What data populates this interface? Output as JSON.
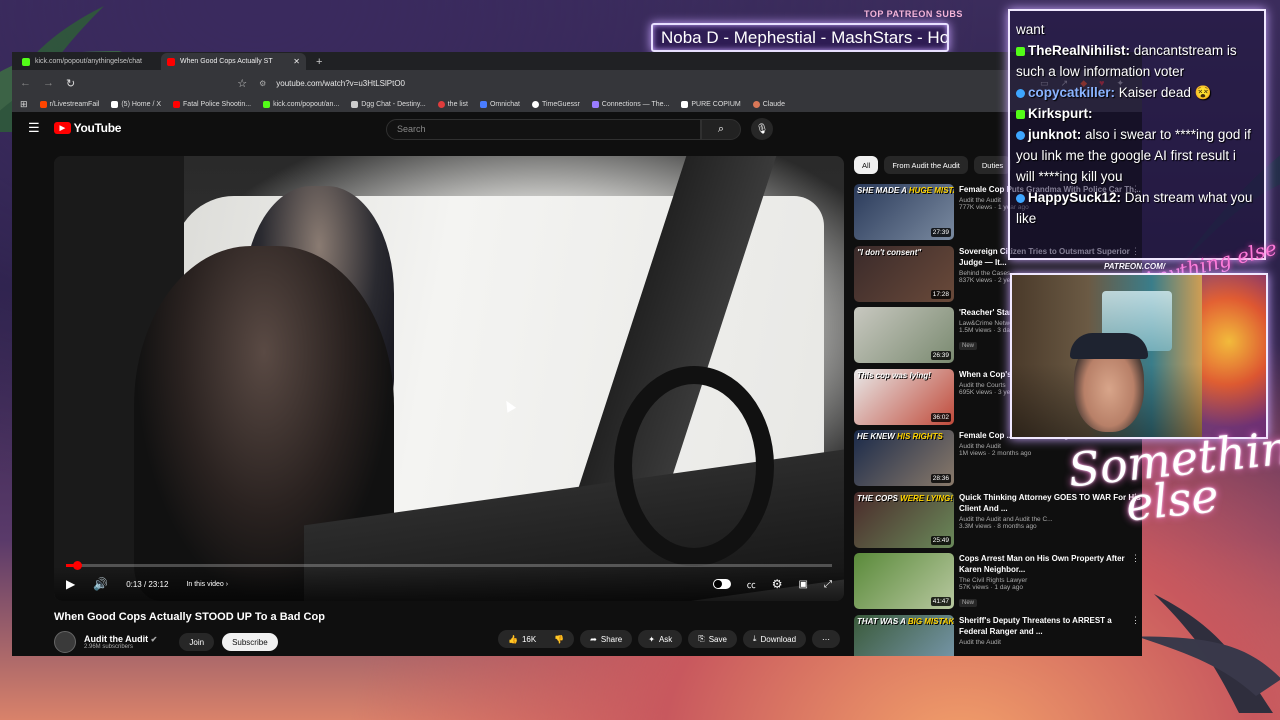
{
  "overlay": {
    "patreon_title": "TOP PATREON SUBS",
    "patreon_ticker": "Noba D - Mephestial - MashStars - Ho",
    "patreon_tag": "PATREON.COM/",
    "signature": "Anything else",
    "brand": "Something else",
    "chat": [
      {
        "badge": "",
        "user": "",
        "text": "want"
      },
      {
        "badge": "k",
        "user": "TheRealNihilist:",
        "text": " dancantstream is such a low information voter"
      },
      {
        "badge": "yt",
        "user": "copycatkiller:",
        "text": " Kaiser dead 😵"
      },
      {
        "badge": "k",
        "user": "Kirkspurt:",
        "text": ""
      },
      {
        "badge": "yt",
        "user": "junknot:",
        "text": " also i swear to ****ing god if you link me the google AI first result i will ****ing kill you"
      },
      {
        "badge": "yt",
        "user": "HappySuck12:",
        "text": " Dan stream what you like"
      }
    ]
  },
  "browser": {
    "tabs": [
      {
        "title": "kick.com/popout/anythingelse/chat",
        "active": false,
        "color": "#53fc18"
      },
      {
        "title": "When Good Cops Actually ST",
        "active": true,
        "color": "#ff0000"
      }
    ],
    "new_tab": "+",
    "url": "youtube.com/watch?v=u3HtLSlPtO0",
    "bookmarks": [
      {
        "label": "r/LivestreamFail",
        "color": "#ff4500"
      },
      {
        "label": "(5) Home / X",
        "color": "#ffffff"
      },
      {
        "label": "Fatal Police Shootin...",
        "color": "#ff0000"
      },
      {
        "label": "kick.com/popout/an...",
        "color": "#53fc18"
      },
      {
        "label": "Dgg Chat - Destiny...",
        "color": "#cccccc"
      },
      {
        "label": "the list",
        "color": "#e03c3c"
      },
      {
        "label": "Omnichat",
        "color": "#4a7dff"
      },
      {
        "label": "TimeGuessr",
        "color": "#ffffff"
      },
      {
        "label": "Connections — The...",
        "color": "#9a7cff"
      },
      {
        "label": "PURE COPIUM",
        "color": "#ffffff"
      },
      {
        "label": "Claude",
        "color": "#d97757"
      }
    ]
  },
  "youtube": {
    "logo": "YouTube",
    "search_placeholder": "Search",
    "player": {
      "time": "0:13 / 23:12",
      "in_this_video": "In this video",
      "progress_fraction": 0.0094
    },
    "video_title": "When Good Cops Actually STOOD UP To a Bad Cop",
    "channel": {
      "name": "Audit the Audit",
      "subs": "2.96M subscribers"
    },
    "join": "Join",
    "subscribe": "Subscribe",
    "likes": "16K",
    "share": "Share",
    "ask": "Ask",
    "save": "Save",
    "download": "Download",
    "chips": [
      "All",
      "From Audit the Audit",
      "Duties"
    ],
    "recs": [
      {
        "cap1": "SHE MADE A ",
        "cap2": "HUGE MISTAKE",
        "title": "Female Cop Puts Grandma With Police Car Th...",
        "channel": "Audit the Audit",
        "views": "777K views · 1 year ago",
        "dur": "27:39",
        "new": false,
        "bg": "linear-gradient(135deg,#2a3a5a,#7a8aa0)"
      },
      {
        "cap1": "\"I don't consent\"",
        "cap2": "",
        "title": "Sovereign Citizen Tries to Outsmart Superior Judge — It...",
        "channel": "Behind the Cases",
        "views": "837K views · 2 years ago",
        "dur": "17:28",
        "new": false,
        "bg": "linear-gradient(135deg,#3a2a2a,#6a4a3a)"
      },
      {
        "cap1": "",
        "cap2": "",
        "title": "'Reacher' Star's Brawl Caugh...",
        "channel": "Law&Crime Network",
        "views": "1.5M views · 3 days ago",
        "dur": "26:39",
        "new": true,
        "bg": "linear-gradient(135deg,#c8c8c0,#7a8a70)"
      },
      {
        "cap1": "This cop was lying!",
        "cap2": "",
        "title": "When a Cop's... IMMEDIATEL...",
        "channel": "Audit the Courts",
        "views": "695K views · 3 years ago",
        "dur": "36:02",
        "new": false,
        "bg": "linear-gradient(135deg,#e8e8e8,#c04a3a)"
      },
      {
        "cap1": "HE KNEW ",
        "cap2": "HIS RIGHTS",
        "title": "Female Cop ... Embarrassing Her Entire ...",
        "channel": "Audit the Audit",
        "views": "1M views · 2 months ago",
        "dur": "28:36",
        "new": false,
        "bg": "linear-gradient(135deg,#1a2a4a,#8a7a6a)"
      },
      {
        "cap1": "THE COPS ",
        "cap2": "WERE LYING!",
        "title": "Quick Thinking Attorney GOES TO WAR For His Client And ...",
        "channel": "Audit the Audit and Audit the C...",
        "views": "3.3M views · 8 months ago",
        "dur": "25:49",
        "new": false,
        "bg": "linear-gradient(135deg,#4a2a2a,#6a8a5a)"
      },
      {
        "cap1": "",
        "cap2": "",
        "title": "Cops Arrest Man on His Own Property After Karen Neighbor...",
        "channel": "The Civil Rights Lawyer",
        "views": "57K views · 1 day ago",
        "dur": "41:47",
        "new": true,
        "bg": "linear-gradient(135deg,#5a8a3a,#b8c8a0)"
      },
      {
        "cap1": "THAT WAS A ",
        "cap2": "BIG MISTAKE",
        "title": "Sheriff's Deputy Threatens to ARREST a Federal Ranger and ...",
        "channel": "Audit the Audit",
        "views": "",
        "dur": "",
        "new": false,
        "bg": "linear-gradient(135deg,#3a5a3a,#7a9ab0)"
      }
    ]
  }
}
